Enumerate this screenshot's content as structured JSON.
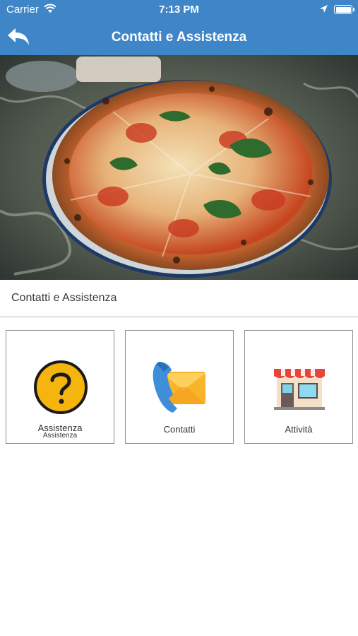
{
  "status_bar": {
    "carrier": "Carrier",
    "time": "7:13 PM"
  },
  "nav": {
    "title": "Contatti e Assistenza",
    "back_icon": "back-arrow-icon"
  },
  "section": {
    "title": "Contatti e Assistenza"
  },
  "tiles": [
    {
      "label": "Assistenza",
      "sublabel": "Assistenza",
      "icon": "question-mark-icon"
    },
    {
      "label": "Contatti",
      "icon": "phone-envelope-icon"
    },
    {
      "label": "Attività",
      "icon": "store-icon"
    }
  ],
  "colors": {
    "header": "#3f86c9",
    "question_yellow": "#f6b40e",
    "envelope_yellow": "#f8b42a",
    "phone_blue": "#3f8ed8",
    "awning_red": "#e8443a"
  }
}
